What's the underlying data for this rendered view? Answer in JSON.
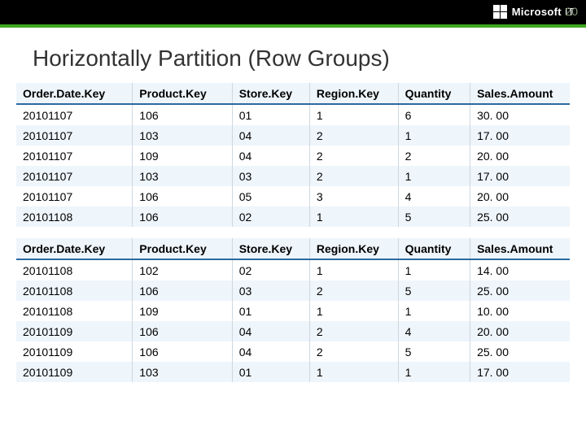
{
  "page_number": "20",
  "brand": {
    "name": "Microsoft",
    "suffix": "IT"
  },
  "title": "Horizontally Partition (Row Groups)",
  "columns": [
    "Order.Date.Key",
    "Product.Key",
    "Store.Key",
    "Region.Key",
    "Quantity",
    "Sales.Amount"
  ],
  "group1": [
    [
      "20101107",
      "106",
      "01",
      "1",
      "6",
      "30. 00"
    ],
    [
      "20101107",
      "103",
      "04",
      "2",
      "1",
      "17. 00"
    ],
    [
      "20101107",
      "109",
      "04",
      "2",
      "2",
      "20. 00"
    ],
    [
      "20101107",
      "103",
      "03",
      "2",
      "1",
      "17. 00"
    ],
    [
      "20101107",
      "106",
      "05",
      "3",
      "4",
      "20. 00"
    ],
    [
      "20101108",
      "106",
      "02",
      "1",
      "5",
      "25. 00"
    ]
  ],
  "group2": [
    [
      "20101108",
      "102",
      "02",
      "1",
      "1",
      "14. 00"
    ],
    [
      "20101108",
      "106",
      "03",
      "2",
      "5",
      "25. 00"
    ],
    [
      "20101108",
      "109",
      "01",
      "1",
      "1",
      "10. 00"
    ],
    [
      "20101109",
      "106",
      "04",
      "2",
      "4",
      "20. 00"
    ],
    [
      "20101109",
      "106",
      "04",
      "2",
      "5",
      "25. 00"
    ],
    [
      "20101109",
      "103",
      "01",
      "1",
      "1",
      "17. 00"
    ]
  ]
}
